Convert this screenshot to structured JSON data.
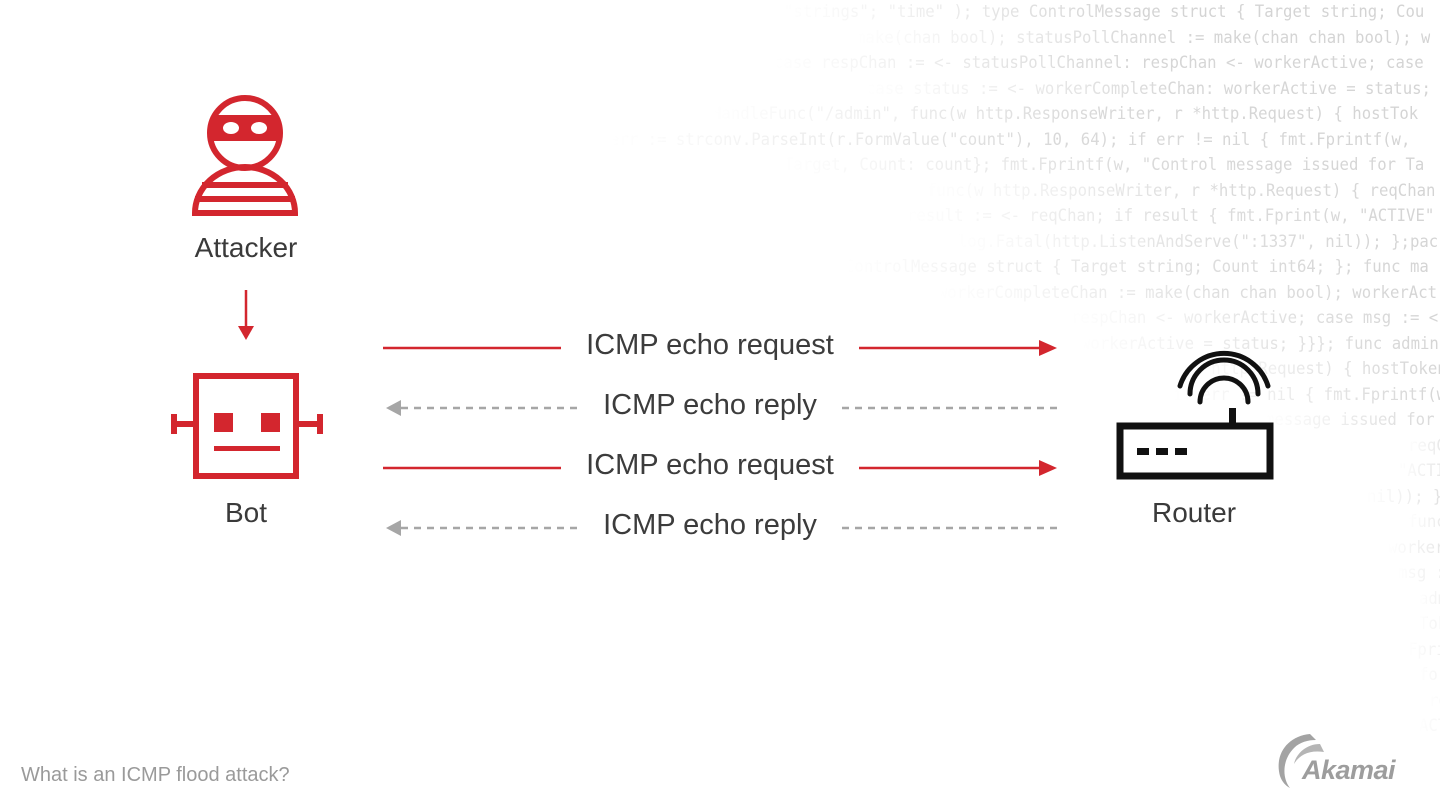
{
  "diagram": {
    "title": "What is an ICMP flood attack?",
    "brand": "Akamai",
    "nodes": {
      "attacker": "Attacker",
      "bot": "Bot",
      "router": "Router"
    },
    "messages": [
      {
        "label": "ICMP echo request",
        "direction": "bot-to-router",
        "style": "solid"
      },
      {
        "label": "ICMP echo reply",
        "direction": "router-to-bot",
        "style": "dashed"
      },
      {
        "label": "ICMP echo request",
        "direction": "bot-to-router",
        "style": "solid"
      },
      {
        "label": "ICMP echo reply",
        "direction": "router-to-bot",
        "style": "dashed"
      }
    ],
    "colors": {
      "accent": "#d3262e",
      "reply": "#a6a6a6",
      "device": "#111111",
      "text": "#3a3a3a"
    }
  },
  "background_code": [
    "\"strings\"; \"time\" ); type ControlMessage struct { Target string; Cou",
    "make(chan bool); statusPollChannel := make(chan chan bool); w",
    "case respChan := <- statusPollChannel: respChan <- workerActive; case",
    "case status := <- workerCompleteChan: workerActive = status;",
    "HandleFunc(\"/admin\", func(w http.ResponseWriter, r *http.Request) { hostTok",
    "err := strconv.ParseInt(r.FormValue(\"count\"), 10, 64); if err != nil { fmt.Fprintf(w,",
    "Target, Count: count}; fmt.Fprintf(w, \"Control message issued for Ta",
    "func(w http.ResponseWriter, r *http.Request) { reqChan",
    "result := <- reqChan; if result { fmt.Fprint(w, \"ACTIVE\"",
    "log.Fatal(http.ListenAndServe(\":1337\", nil)); };pac",
    "ControlMessage struct { Target string; Count int64; }; func ma",
    "workerCompleteChan := make(chan chan bool); workerAct",
    "respChan <- workerActive; case msg := <-",
    "workerActive = status; }}}; func admin(",
    "r *http.Request) { hostTokens",
    "if err != nil { fmt.Fprintf(w,",
    "message issued for Ta",
    "reqChan",
    "\"ACTIVE\"",
    "nil)); };pa",
    "func ma",
    "workerAct",
    "msg := <",
    "admin(",
    "Tokens",
    "Fprintf",
    "for Ta",
    "reqCh",
    "ACTIVE"
  ]
}
